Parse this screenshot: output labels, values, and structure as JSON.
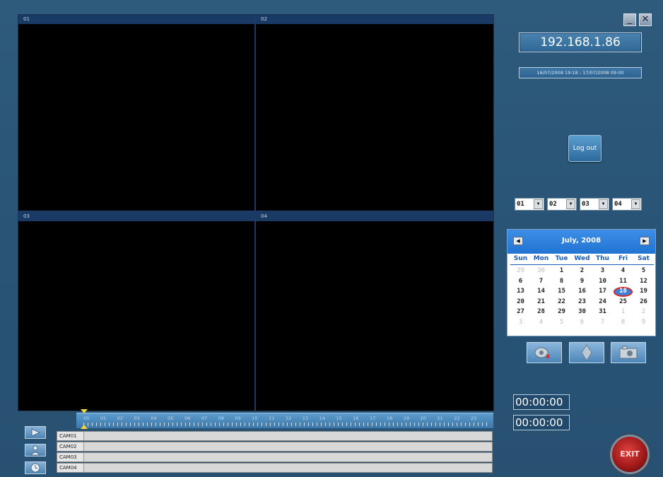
{
  "window": {
    "minimize_label": "_",
    "close_label": "✕"
  },
  "panes": [
    {
      "label": "01"
    },
    {
      "label": "02"
    },
    {
      "label": "03"
    },
    {
      "label": "04"
    }
  ],
  "server": {
    "ip": "192.168.1.86",
    "range": "16/07/2008 19:18 - 17/07/2008 09:00"
  },
  "logout_label": "Log out",
  "channel_selects": [
    "01",
    "02",
    "03",
    "04"
  ],
  "calendar": {
    "title": "July, 2008",
    "days_of_week": [
      "Sun",
      "Mon",
      "Tue",
      "Wed",
      "Thu",
      "Fri",
      "Sat"
    ],
    "weeks": [
      [
        "29",
        "30",
        "1",
        "2",
        "3",
        "4",
        "5"
      ],
      [
        "6",
        "7",
        "8",
        "9",
        "10",
        "11",
        "12"
      ],
      [
        "13",
        "14",
        "15",
        "16",
        "17",
        "18",
        "19"
      ],
      [
        "20",
        "21",
        "22",
        "23",
        "24",
        "25",
        "26"
      ],
      [
        "27",
        "28",
        "29",
        "30",
        "31",
        "1",
        "2"
      ],
      [
        "3",
        "4",
        "5",
        "6",
        "7",
        "8",
        "9"
      ]
    ],
    "selected_day": "18"
  },
  "times": {
    "start": "00:00:00",
    "end": "00:00:00"
  },
  "timeline": {
    "hours": [
      "00",
      "01",
      "02",
      "03",
      "04",
      "05",
      "06",
      "07",
      "08",
      "09",
      "10",
      "11",
      "12",
      "13",
      "14",
      "15",
      "16",
      "17",
      "18",
      "19",
      "20",
      "21",
      "22",
      "23"
    ]
  },
  "channels": [
    "CAM01",
    "CAM02",
    "CAM03",
    "CAM04"
  ],
  "exit_label": "EXIT",
  "icons": {
    "tool_1": "camera-delete-icon",
    "tool_2": "diamond-icon",
    "tool_3": "snapshot-icon",
    "left_1": "play-icon",
    "left_2": "user-icon",
    "left_3": "clock-icon"
  }
}
